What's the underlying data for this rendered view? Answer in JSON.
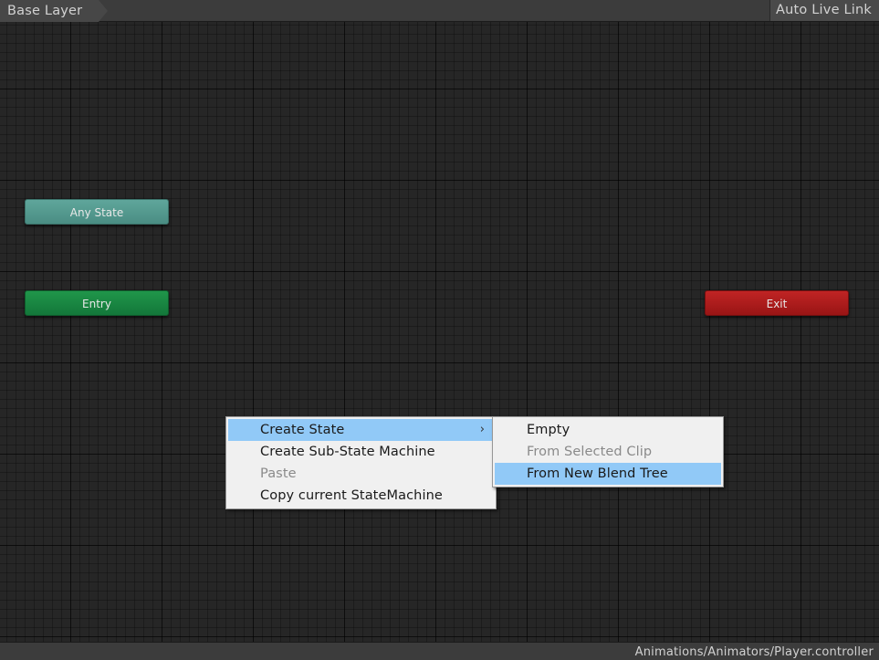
{
  "toolbar": {
    "breadcrumb": "Base Layer",
    "auto_live_link": "Auto Live Link"
  },
  "graph": {
    "nodes": {
      "any_state": "Any State",
      "entry": "Entry",
      "exit": "Exit"
    },
    "node_colors": {
      "any_state": "#56998f",
      "entry": "#188540",
      "exit": "#ad1c1c"
    }
  },
  "context_menu": {
    "items": [
      {
        "label": "Create State",
        "highlighted": true,
        "has_submenu": true
      },
      {
        "label": "Create Sub-State Machine",
        "highlighted": false
      },
      {
        "label": "Paste",
        "disabled": true
      },
      {
        "label": "Copy current StateMachine",
        "highlighted": false
      }
    ],
    "submenu_icon": "chevron-right-icon",
    "submenu_glyph": "›"
  },
  "submenu": {
    "items": [
      {
        "label": "Empty",
        "highlighted": false
      },
      {
        "label": "From Selected Clip",
        "disabled": true
      },
      {
        "label": "From New Blend Tree",
        "highlighted": true
      }
    ]
  },
  "statusbar": {
    "path": "Animations/Animators/Player.controller"
  },
  "colors": {
    "menu_highlight": "#91c9f7",
    "canvas_background": "#262626"
  }
}
